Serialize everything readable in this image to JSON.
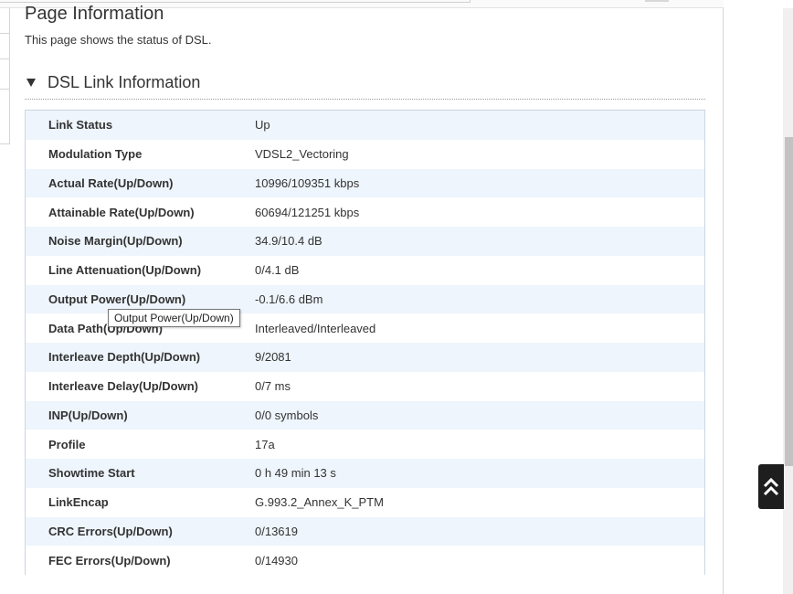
{
  "page": {
    "title": "Page Information",
    "description": "This page shows the status of DSL."
  },
  "section": {
    "title": "DSL Link Information"
  },
  "rows": [
    {
      "label": "Link Status",
      "value": "Up"
    },
    {
      "label": "Modulation Type",
      "value": "VDSL2_Vectoring"
    },
    {
      "label": "Actual Rate(Up/Down)",
      "value": "10996/109351 kbps"
    },
    {
      "label": "Attainable Rate(Up/Down)",
      "value": "60694/121251 kbps"
    },
    {
      "label": "Noise Margin(Up/Down)",
      "value": "34.9/10.4 dB"
    },
    {
      "label": "Line Attenuation(Up/Down)",
      "value": "0/4.1 dB"
    },
    {
      "label": "Output Power(Up/Down)",
      "value": "-0.1/6.6 dBm"
    },
    {
      "label": "Data Path(Up/Down)",
      "value": "Interleaved/Interleaved"
    },
    {
      "label": "Interleave Depth(Up/Down)",
      "value": "9/2081"
    },
    {
      "label": "Interleave Delay(Up/Down)",
      "value": "0/7 ms"
    },
    {
      "label": "INP(Up/Down)",
      "value": "0/0 symbols"
    },
    {
      "label": "Profile",
      "value": "17a"
    },
    {
      "label": "Showtime Start",
      "value": "0 h 49 min 13 s"
    },
    {
      "label": "LinkEncap",
      "value": "G.993.2_Annex_K_PTM"
    },
    {
      "label": "CRC Errors(Up/Down)",
      "value": "0/13619"
    },
    {
      "label": "FEC Errors(Up/Down)",
      "value": "0/14930"
    }
  ],
  "tooltip": {
    "text": "Output Power(Up/Down)"
  },
  "icons": {
    "section_toggle": "caret-down-icon",
    "back_to_top": "double-chevron-up-icon"
  },
  "colors": {
    "row_alt": "#eef5fc",
    "table_border": "#c9d6e3",
    "back_to_top_bg": "#1e1e1e"
  }
}
